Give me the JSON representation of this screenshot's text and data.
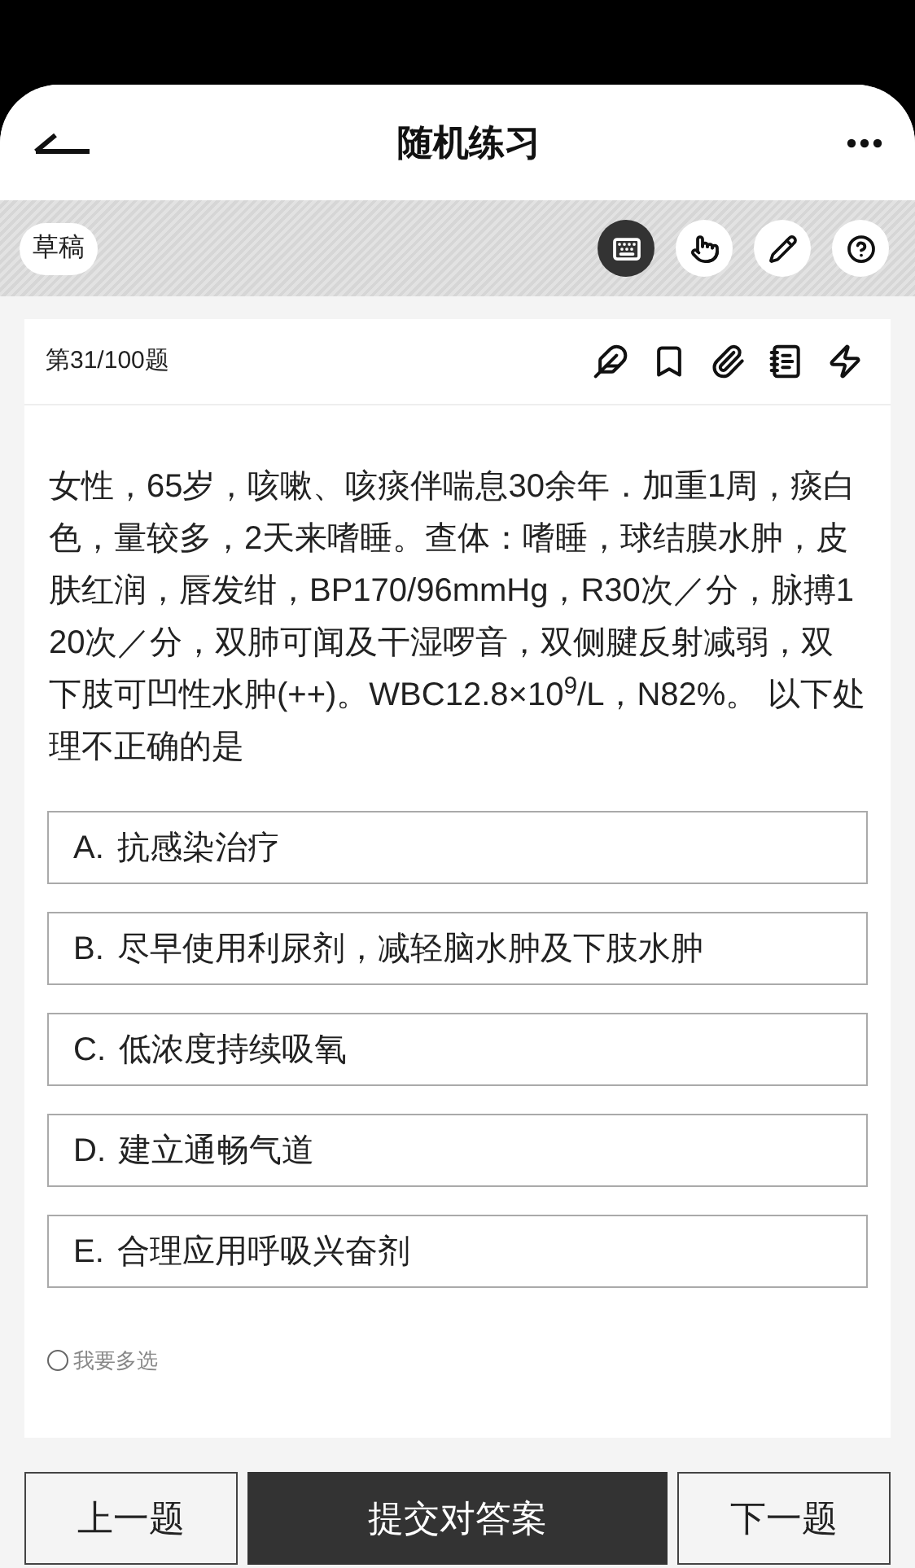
{
  "header": {
    "title": "随机练习"
  },
  "toolbar": {
    "draft_label": "草稿",
    "tools": [
      {
        "kind": "keyboard",
        "selected": true
      },
      {
        "kind": "tap",
        "selected": false
      },
      {
        "kind": "pencil",
        "selected": false
      },
      {
        "kind": "help",
        "selected": false
      }
    ]
  },
  "question": {
    "counter": "第31/100题",
    "actions": [
      {
        "kind": "feather"
      },
      {
        "kind": "bookmark"
      },
      {
        "kind": "paperclip"
      },
      {
        "kind": "notebook"
      },
      {
        "kind": "bolt"
      }
    ],
    "text": "女性，65岁，咳嗽、咳痰伴喘息30余年．加重1周，痰白色，量较多，2天来嗜睡。查体：嗜睡，球结膜水肿，皮肤红润，唇发绀，BP170/96mmHg，R30次／分，脉搏120次／分，双肺可闻及干湿啰音，双侧腱反射减弱，双下肢可凹性水肿(++)。WBC12.8×10$^{9}$/L，N82%。 以下处理不正确的是",
    "options": [
      {
        "letter": "A.",
        "text": "抗感染治疗",
        "selected": false
      },
      {
        "letter": "B.",
        "text": "尽早使用利尿剂，减轻脑水肿及下肢水肿",
        "selected": false
      },
      {
        "letter": "C.",
        "text": "低浓度持续吸氧",
        "selected": false
      },
      {
        "letter": "D.",
        "text": "建立通畅气道",
        "selected": false
      },
      {
        "letter": "E.",
        "text": "合理应用呼吸兴奋剂",
        "selected": false
      }
    ],
    "multi_select": {
      "label": "我要多选",
      "checked": false
    }
  },
  "footer": {
    "prev": "上一题",
    "submit": "提交对答案",
    "next": "下一题"
  }
}
